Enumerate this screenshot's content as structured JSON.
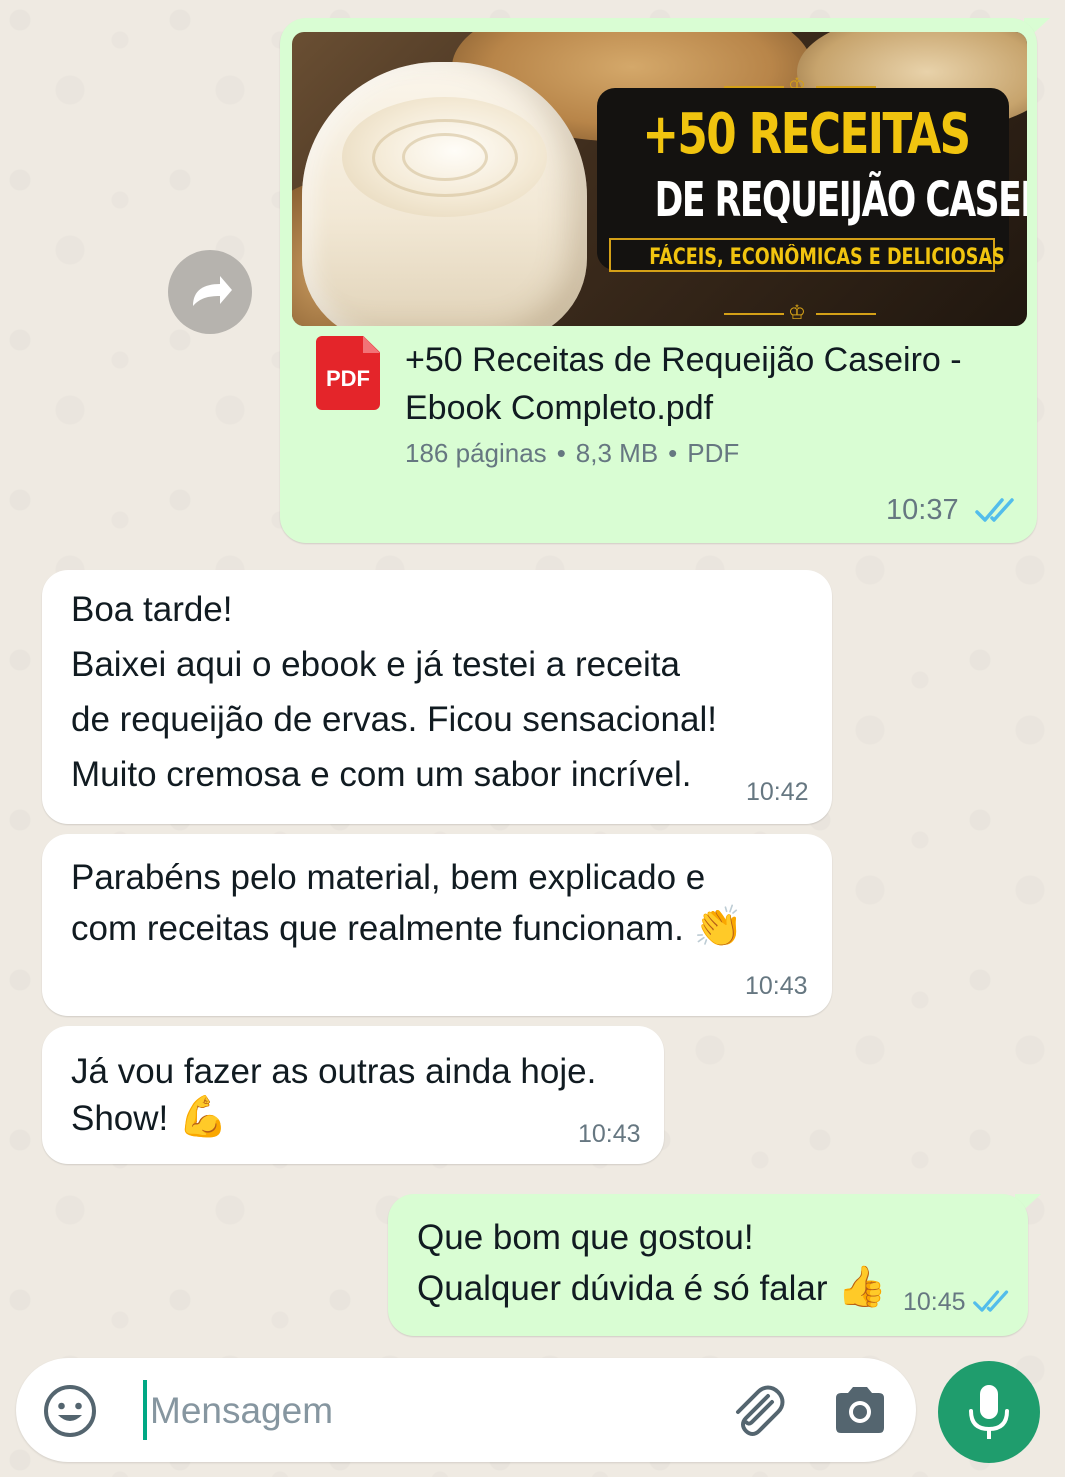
{
  "chat": {
    "document_message": {
      "preview": {
        "title_line1": "+50 RECEITAS",
        "title_line2": "DE REQUEIJÃO CASEIRO",
        "subtitle": "FÁCEIS, ECONÔMICAS E DELICIOSAS"
      },
      "file_icon_label": "PDF",
      "file_name": "+50 Receitas de Requeijão Caseiro - Ebook Completo.pdf",
      "pages": "186 páginas",
      "size": "8,3 MB",
      "type": "PDF",
      "meta_separator": "•",
      "time": "10:37",
      "status": "read"
    },
    "forward_button": {
      "icon": "forward-arrow-icon"
    },
    "messages": [
      {
        "direction": "incoming",
        "lines": [
          "Boa tarde!",
          "Baixei aqui o ebook e já testei a receita",
          "de requeijão de ervas. Ficou sensacional!",
          "Muito cremosa e com um sabor incrível."
        ],
        "time": "10:42"
      },
      {
        "direction": "incoming",
        "lines": [
          "Parabéns pelo material, bem explicado e",
          "com receitas que realmente funcionam."
        ],
        "emoji": "👏",
        "time": "10:43"
      },
      {
        "direction": "incoming",
        "lines": [
          "Já vou fazer as outras ainda hoje.",
          "Show!"
        ],
        "emoji": "💪",
        "time": "10:43"
      },
      {
        "direction": "outgoing",
        "lines": [
          "Que bom que gostou!",
          "Qualquer dúvida é só falar"
        ],
        "emoji": "👍",
        "time": "10:45",
        "status": "read"
      }
    ]
  },
  "composer": {
    "placeholder": "Mensagem",
    "emoji_icon": "emoji-icon",
    "attach_icon": "paperclip-icon",
    "camera_icon": "camera-icon",
    "mic_icon": "microphone-icon"
  },
  "colors": {
    "background": "#efeae2",
    "outgoing_bubble": "#d9fdd3",
    "incoming_bubble": "#ffffff",
    "read_ticks": "#53bdeb",
    "accent": "#1f9d6d",
    "pdf_red": "#e4252a"
  }
}
